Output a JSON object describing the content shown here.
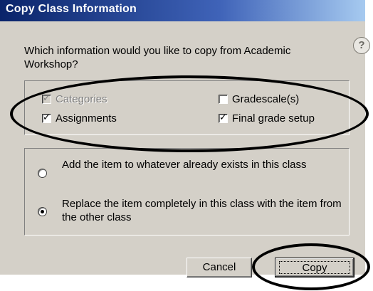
{
  "dialog": {
    "title": "Copy Class Information",
    "help_label": "?",
    "question": "Which information would you like to copy from Academic Workshop?",
    "checkboxes": [
      {
        "label": "Categories",
        "checked": true,
        "disabled": true
      },
      {
        "label": "Gradescale(s)",
        "checked": false,
        "disabled": false
      },
      {
        "label": "Assignments",
        "checked": true,
        "disabled": false
      },
      {
        "label": "Final grade setup",
        "checked": true,
        "disabled": false
      }
    ],
    "radios": [
      {
        "label": "Add the item to whatever already exists in this class",
        "selected": false
      },
      {
        "label": "Replace the item completely in this class with the item from the other class",
        "selected": true
      }
    ],
    "buttons": {
      "cancel": "Cancel",
      "copy": "Copy"
    }
  },
  "colors": {
    "titlebar": "#0a246a",
    "face": "#d4d0c8"
  }
}
